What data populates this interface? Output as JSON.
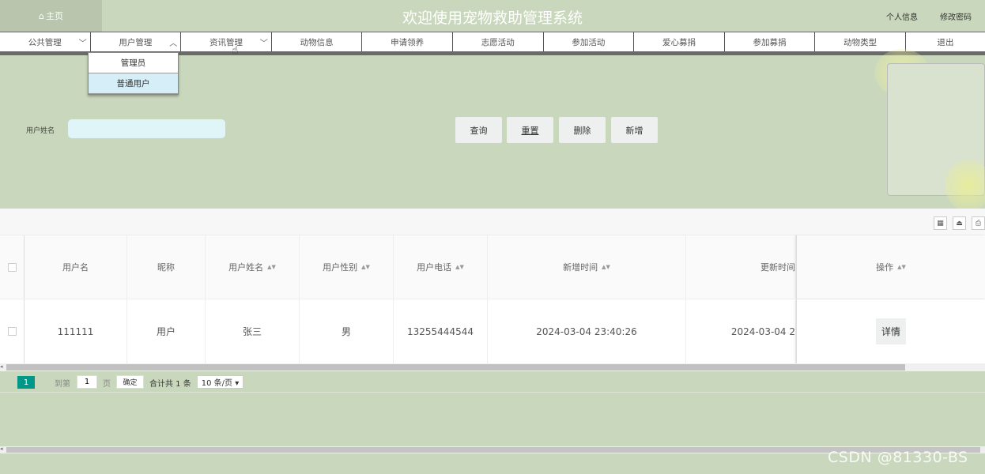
{
  "header": {
    "home_icon": "⌂",
    "home_label": "主页",
    "title": "欢迎使用宠物救助管理系统",
    "profile_link": "个人信息",
    "password_link": "修改密码"
  },
  "nav": {
    "items": [
      {
        "label": "公共管理",
        "dropdown": true,
        "chevron": "﹀"
      },
      {
        "label": "用户管理",
        "dropdown": true,
        "chevron": "︿"
      },
      {
        "label": "资讯管理",
        "dropdown": true,
        "chevron": "﹀"
      },
      {
        "label": "动物信息"
      },
      {
        "label": "申请领养"
      },
      {
        "label": "志愿活动"
      },
      {
        "label": "参加活动"
      },
      {
        "label": "爱心募捐"
      },
      {
        "label": "参加募捐"
      },
      {
        "label": "动物类型"
      },
      {
        "label": "退出"
      }
    ],
    "user_dropdown": [
      "管理员",
      "普通用户"
    ]
  },
  "search": {
    "name_label": "用户姓名",
    "name_value": "",
    "buttons": {
      "query": "查询",
      "reset": "重置",
      "delete": "删除",
      "add": "新增"
    }
  },
  "table": {
    "columns": [
      "用户名",
      "昵称",
      "用户姓名",
      "用户性别",
      "用户电话",
      "新增时间",
      "更新时间",
      "操作"
    ],
    "sortable": [
      false,
      false,
      true,
      true,
      true,
      true,
      false,
      true
    ],
    "rows": [
      {
        "cells": [
          "111111",
          "用户",
          "张三",
          "男",
          "13255444544",
          "2024-03-04 23:40:26",
          "2024-03-04 2"
        ],
        "action": "详情"
      }
    ]
  },
  "pager": {
    "current_page": "1",
    "goto_label": "到第",
    "page_input": "1",
    "page_suffix": "页",
    "confirm": "确定",
    "total": "合计共 1 条",
    "page_size": "10 条/页 ▾"
  },
  "watermark": "CSDN @81330-BS"
}
